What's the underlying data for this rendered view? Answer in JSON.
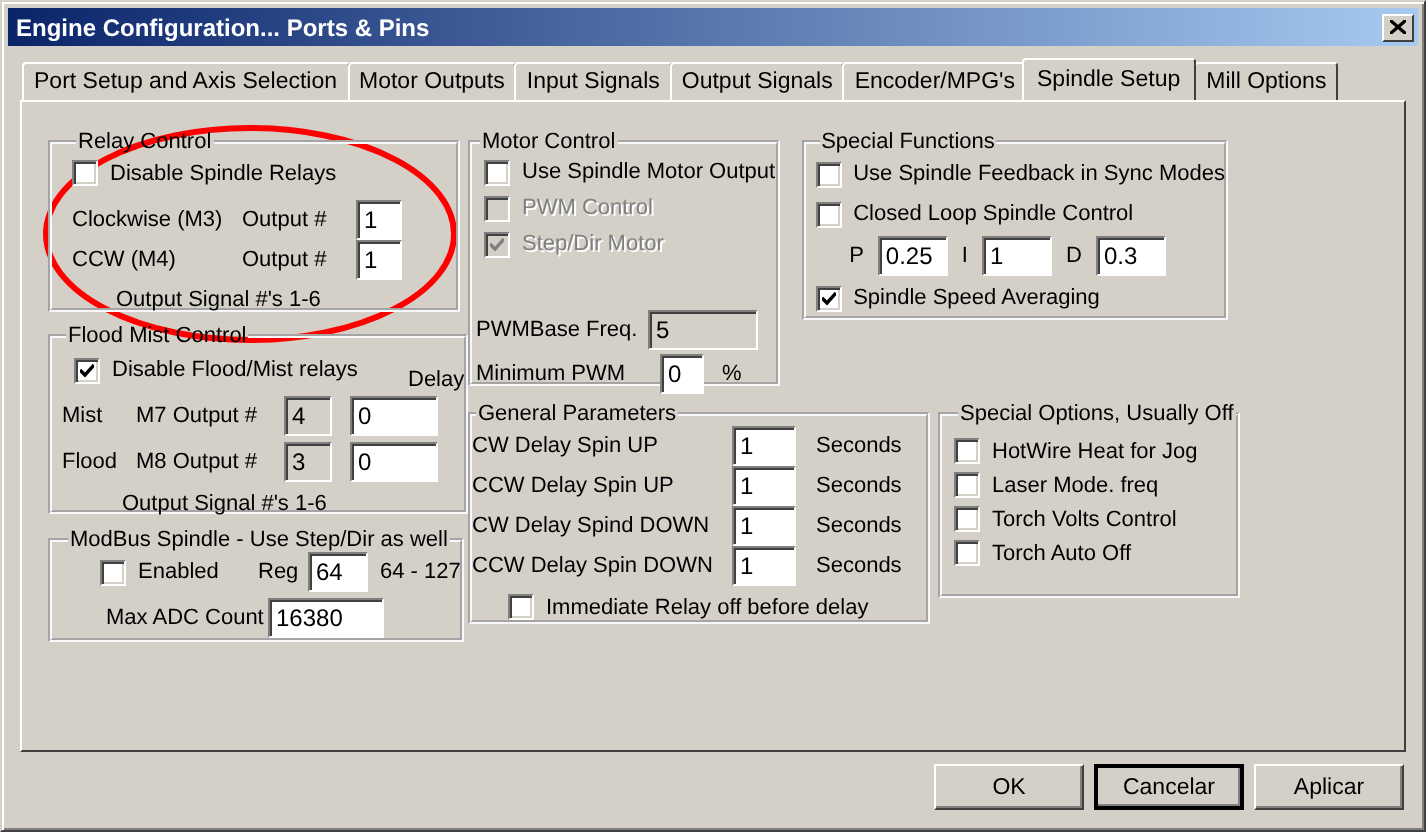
{
  "window": {
    "title": "Engine Configuration... Ports & Pins"
  },
  "tabs": [
    {
      "label": "Port Setup and Axis Selection",
      "selected": false
    },
    {
      "label": "Motor Outputs",
      "selected": false
    },
    {
      "label": "Input Signals",
      "selected": false
    },
    {
      "label": "Output Signals",
      "selected": false
    },
    {
      "label": "Encoder/MPG's",
      "selected": false
    },
    {
      "label": "Spindle Setup",
      "selected": true
    },
    {
      "label": "Mill Options",
      "selected": false
    }
  ],
  "groups": [
    {
      "kind": "relay",
      "title": "Relay Control",
      "rows": [
        [
          {
            "kind": "checkbox",
            "label": "Disable Spindle Relays",
            "checked": false,
            "disabled": false
          }
        ],
        [
          {
            "kind": "text",
            "text": "Clockwise (M3)"
          },
          {
            "kind": "text",
            "text": "Output #"
          },
          {
            "kind": "input",
            "value": "1",
            "readonly": false
          }
        ],
        [
          {
            "kind": "text",
            "text": "CCW (M4)"
          },
          {
            "kind": "text",
            "text": "Output #"
          },
          {
            "kind": "input",
            "value": "1",
            "readonly": false
          }
        ],
        [
          {
            "kind": "note",
            "text": "Output Signal #'s 1-6"
          }
        ]
      ]
    },
    {
      "kind": "flood",
      "title": "Flood Mist Control",
      "rows": [
        [
          {
            "kind": "checkbox",
            "label": "Disable Flood/Mist relays",
            "checked": true,
            "disabled": false
          },
          {
            "kind": "empty"
          },
          {
            "kind": "empty"
          },
          {
            "kind": "text",
            "text": "Delay"
          }
        ],
        [
          {
            "kind": "text",
            "text": "Mist"
          },
          {
            "kind": "text",
            "text": "M7 Output #"
          },
          {
            "kind": "input",
            "value": "4",
            "readonly": true
          },
          {
            "kind": "input",
            "value": "0",
            "readonly": false
          }
        ],
        [
          {
            "kind": "text",
            "text": "Flood"
          },
          {
            "kind": "text",
            "text": "M8 Output #"
          },
          {
            "kind": "input",
            "value": "3",
            "readonly": true
          },
          {
            "kind": "input",
            "value": "0",
            "readonly": false
          }
        ],
        [
          {
            "kind": "note",
            "text": "Output Signal #'s 1-6"
          }
        ]
      ]
    },
    {
      "kind": "modbus",
      "title": "ModBus Spindle - Use Step/Dir as well",
      "rows": [
        [
          {
            "kind": "checkbox",
            "label": "Enabled",
            "checked": false,
            "disabled": false
          },
          {
            "kind": "text",
            "text": "Reg"
          },
          {
            "kind": "input",
            "value": "64",
            "readonly": false
          },
          {
            "kind": "text",
            "text": "64 - 127"
          }
        ],
        [
          {
            "kind": "text",
            "text": "Max ADC Count"
          },
          {
            "kind": "input",
            "value": "16380",
            "readonly": false
          }
        ]
      ]
    },
    {
      "kind": "motor",
      "title": "Motor Control",
      "rows": [
        [
          {
            "kind": "checkbox",
            "label": "Use Spindle Motor Output",
            "checked": false,
            "disabled": false
          }
        ],
        [
          {
            "kind": "checkbox",
            "label": "PWM Control",
            "checked": false,
            "disabled": true
          }
        ],
        [
          {
            "kind": "checkbox",
            "label": "Step/Dir Motor",
            "checked": true,
            "disabled": true
          }
        ],
        [
          {
            "kind": "text",
            "text": "PWMBase Freq."
          },
          {
            "kind": "input",
            "value": "5",
            "readonly": true
          }
        ],
        [
          {
            "kind": "text",
            "text": "Minimum PWM"
          },
          {
            "kind": "input",
            "value": "0",
            "readonly": false
          },
          {
            "kind": "text",
            "text": "%"
          }
        ]
      ]
    },
    {
      "kind": "special",
      "title": "Special Functions",
      "rows": [
        [
          {
            "kind": "checkbox",
            "label": "Use Spindle Feedback in Sync Modes",
            "checked": false,
            "disabled": false
          }
        ],
        [
          {
            "kind": "checkbox",
            "label": "Closed Loop Spindle Control",
            "checked": false,
            "disabled": false
          }
        ],
        [
          {
            "kind": "text",
            "text": "P"
          },
          {
            "kind": "input",
            "value": "0.25",
            "readonly": false
          },
          {
            "kind": "text",
            "text": "I"
          },
          {
            "kind": "input",
            "value": "1",
            "readonly": false
          },
          {
            "kind": "text",
            "text": "D"
          },
          {
            "kind": "input",
            "value": "0.3",
            "readonly": false
          }
        ],
        [
          {
            "kind": "checkbox",
            "label": "Spindle Speed Averaging",
            "checked": true,
            "disabled": false
          }
        ]
      ]
    },
    {
      "kind": "general",
      "title": "General Parameters",
      "rows": [
        [
          {
            "kind": "text",
            "text": "CW Delay Spin UP"
          },
          {
            "kind": "input",
            "value": "1",
            "readonly": false
          },
          {
            "kind": "text",
            "text": "Seconds"
          }
        ],
        [
          {
            "kind": "text",
            "text": "CCW Delay Spin UP"
          },
          {
            "kind": "input",
            "value": "1",
            "readonly": false
          },
          {
            "kind": "text",
            "text": "Seconds"
          }
        ],
        [
          {
            "kind": "text",
            "text": "CW Delay Spind DOWN"
          },
          {
            "kind": "input",
            "value": "1",
            "readonly": false
          },
          {
            "kind": "text",
            "text": "Seconds"
          }
        ],
        [
          {
            "kind": "text",
            "text": "CCW Delay Spin DOWN"
          },
          {
            "kind": "input",
            "value": "1",
            "readonly": false
          },
          {
            "kind": "text",
            "text": "Seconds"
          }
        ],
        [
          {
            "kind": "checkbox",
            "label": "Immediate Relay off before delay",
            "checked": false,
            "disabled": false
          }
        ]
      ]
    },
    {
      "kind": "options",
      "title": "Special Options, Usually Off",
      "rows": [
        [
          {
            "kind": "checkbox",
            "label": "HotWire Heat for Jog",
            "checked": false,
            "disabled": false
          }
        ],
        [
          {
            "kind": "checkbox",
            "label": "Laser Mode. freq",
            "checked": false,
            "disabled": false
          }
        ],
        [
          {
            "kind": "checkbox",
            "label": "Torch Volts Control",
            "checked": false,
            "disabled": false
          }
        ],
        [
          {
            "kind": "checkbox",
            "label": "Torch Auto Off",
            "checked": false,
            "disabled": false
          }
        ]
      ]
    }
  ],
  "buttons": [
    {
      "label": "OK",
      "default": false
    },
    {
      "label": "Cancelar",
      "default": true
    },
    {
      "label": "Aplicar",
      "default": false
    }
  ],
  "annotation": {
    "kind": "ellipse"
  }
}
